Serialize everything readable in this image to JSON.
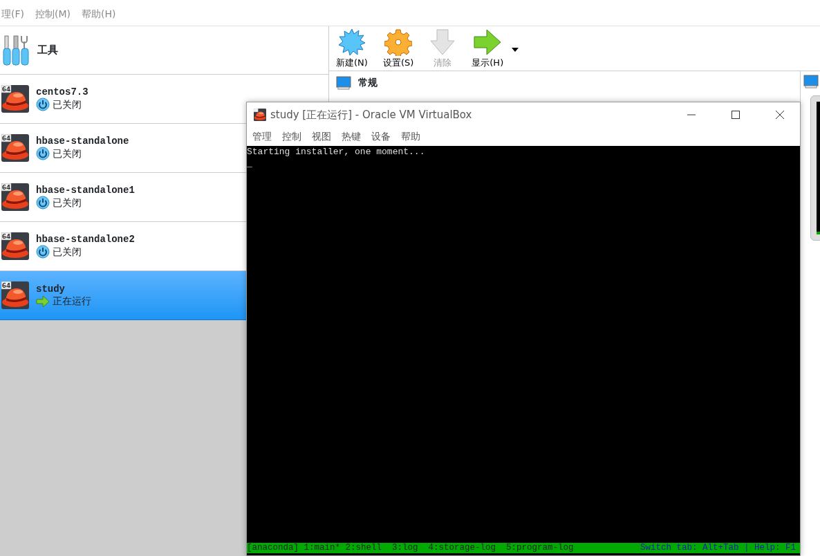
{
  "menu": [
    {
      "label": "理(F)"
    },
    {
      "label": "控制(M)"
    },
    {
      "label": "帮助(H)"
    }
  ],
  "tools": {
    "label": "工具"
  },
  "machines": [
    {
      "name": "centos7.3",
      "badge": "64",
      "state": "已关闭",
      "kind": "off",
      "selected": false
    },
    {
      "name": "hbase-standalone",
      "badge": "64",
      "state": "已关闭",
      "kind": "off",
      "selected": false
    },
    {
      "name": "hbase-standalone1",
      "badge": "64",
      "state": "已关闭",
      "kind": "off",
      "selected": false
    },
    {
      "name": "hbase-standalone2",
      "badge": "64",
      "state": "已关闭",
      "kind": "off",
      "selected": false
    },
    {
      "name": "study",
      "badge": "64",
      "state": "正在运行",
      "kind": "running",
      "selected": true
    }
  ],
  "toolbar": [
    {
      "label": "新建(N)",
      "kind": "new",
      "disabled": false
    },
    {
      "label": "设置(S)",
      "kind": "settings",
      "disabled": false
    },
    {
      "label": "清除",
      "kind": "discard",
      "disabled": true
    },
    {
      "label": "显示(H)",
      "kind": "show",
      "disabled": false
    }
  ],
  "details": {
    "section": "常规"
  },
  "vm_window": {
    "title": "study [正在运行] - Oracle VM VirtualBox",
    "menu": [
      {
        "label": "管理"
      },
      {
        "label": "控制"
      },
      {
        "label": "视图"
      },
      {
        "label": "热键"
      },
      {
        "label": "设备"
      },
      {
        "label": "帮助"
      }
    ],
    "console_lines": [
      "Starting installer, one moment...",
      "_"
    ],
    "status_bar": {
      "tabs": "[anaconda] 1:main* 2:shell  3:log  4:storage-log  5:program-log",
      "help": "Switch tab: Alt+Tab | Help: F1"
    }
  }
}
